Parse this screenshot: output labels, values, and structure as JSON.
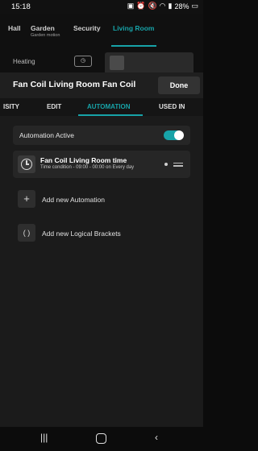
{
  "status": {
    "time": "15:18",
    "battery": "28%",
    "icons": [
      "image-icon",
      "notification-icon",
      "alarm-icon",
      "mute-icon",
      "wifi-icon",
      "signal-icon",
      "battery-icon"
    ]
  },
  "background": {
    "tabs": [
      {
        "label": "Hall",
        "sub": ""
      },
      {
        "label": "Garden",
        "sub": "Garden motion"
      },
      {
        "label": "Security",
        "sub": ""
      },
      {
        "label": "Living Room",
        "sub": ""
      }
    ],
    "heating_label": "Heating"
  },
  "dialog": {
    "title": "Fan Coil Living Room Fan Coil",
    "done_label": "Done"
  },
  "tabs": [
    {
      "label": "ISITY"
    },
    {
      "label": "EDIT"
    },
    {
      "label": "AUTOMATION"
    },
    {
      "label": "USED IN"
    }
  ],
  "active_tab": "AUTOMATION",
  "automation_active": {
    "label": "Automation Active",
    "enabled": true
  },
  "automation_item": {
    "title": "Fan Coil Living Room time",
    "subtitle": "Time condition - 09:00 - 00:00 on Every day",
    "icon": "clock-icon"
  },
  "actions": {
    "add_automation": "Add new Automation",
    "add_brackets": "Add new Logical Brackets",
    "add_automation_icon": "+",
    "add_brackets_icon": "( )"
  },
  "accent": "#17a3a8"
}
